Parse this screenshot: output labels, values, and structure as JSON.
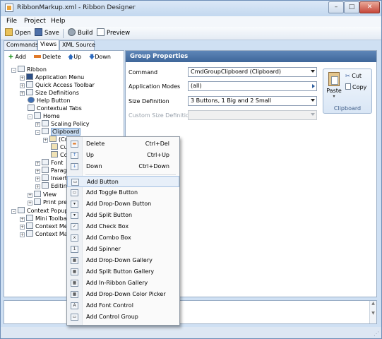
{
  "window": {
    "title": "RibbonMarkup.xml - Ribbon Designer",
    "controls": {
      "minimize": "–",
      "maximize": "□",
      "close": "✕"
    }
  },
  "menubar": [
    "File",
    "Project",
    "Help"
  ],
  "toolbar": {
    "open": "Open",
    "save": "Save",
    "build": "Build",
    "preview": "Preview"
  },
  "tabs": [
    "Commands",
    "Views",
    "XML Source"
  ],
  "active_tab": "Views",
  "tree_toolbar": {
    "add": "Add",
    "delete": "Delete",
    "up": "Up",
    "down": "Down"
  },
  "tree": [
    {
      "label": "Ribbon",
      "exp": "–"
    },
    {
      "label": "Application Menu",
      "exp": "+"
    },
    {
      "label": "Quick Access Toolbar",
      "exp": "+"
    },
    {
      "label": "Size Definitions",
      "exp": "+"
    },
    {
      "label": "Help Button",
      "exp": ""
    },
    {
      "label": "Contextual Tabs",
      "exp": ""
    },
    {
      "label": "Home",
      "exp": "–"
    },
    {
      "label": "Scaling Policy",
      "exp": "+"
    },
    {
      "label": "Clipboard",
      "exp": "–"
    },
    {
      "label": "(CmdP",
      "exp": "+"
    },
    {
      "label": "Cut",
      "exp": ""
    },
    {
      "label": "Copy",
      "exp": ""
    },
    {
      "label": "Font",
      "exp": "+"
    },
    {
      "label": "Paragrap",
      "exp": "+"
    },
    {
      "label": "Insert",
      "exp": "+"
    },
    {
      "label": "Editing",
      "exp": "+"
    },
    {
      "label": "View",
      "exp": "+"
    },
    {
      "label": "Print preview",
      "exp": "+"
    },
    {
      "label": "Context Popup",
      "exp": "–"
    },
    {
      "label": "Mini Toolbars",
      "exp": "+"
    },
    {
      "label": "Context Menu",
      "exp": "+"
    },
    {
      "label": "Context Map",
      "exp": "+"
    }
  ],
  "group_properties": {
    "header": "Group Properties",
    "command_label": "Command",
    "command_value": "CmdGroupClipboard (Clipboard)",
    "app_modes_label": "Application Modes",
    "app_modes_value": "(all)",
    "size_def_label": "Size Definition",
    "size_def_value": "3 Buttons, 1 Big and 2 Small",
    "custom_size_label": "Custom Size Definition",
    "custom_size_value": ""
  },
  "preview": {
    "paste": "Paste",
    "cut": "Cut",
    "copy": "Copy",
    "caption": "Clipboard"
  },
  "context_menu": {
    "top": [
      {
        "label": "Delete",
        "shortcut": "Ctrl+Del",
        "icon": "▬"
      },
      {
        "label": "Up",
        "shortcut": "Ctrl+Up",
        "icon": "↑"
      },
      {
        "label": "Down",
        "shortcut": "Ctrl+Down",
        "icon": "↓"
      }
    ],
    "add": [
      {
        "label": "Add Button",
        "icon": "▭"
      },
      {
        "label": "Add Toggle Button",
        "icon": "▭"
      },
      {
        "label": "Add Drop-Down Button",
        "icon": "▾"
      },
      {
        "label": "Add Split Button",
        "icon": "▾"
      },
      {
        "label": "Add Check Box",
        "icon": "✓"
      },
      {
        "label": "Add Combo Box",
        "icon": "x"
      },
      {
        "label": "Add Spinner",
        "icon": "1"
      },
      {
        "label": "Add Drop-Down Gallery",
        "icon": "▦"
      },
      {
        "label": "Add Split Button Gallery",
        "icon": "▦"
      },
      {
        "label": "Add In-Ribbon Gallery",
        "icon": "▦"
      },
      {
        "label": "Add Drop-Down Color Picker",
        "icon": "▦"
      },
      {
        "label": "Add Font Control",
        "icon": "A"
      },
      {
        "label": "Add Control Group",
        "icon": "▭"
      }
    ]
  }
}
